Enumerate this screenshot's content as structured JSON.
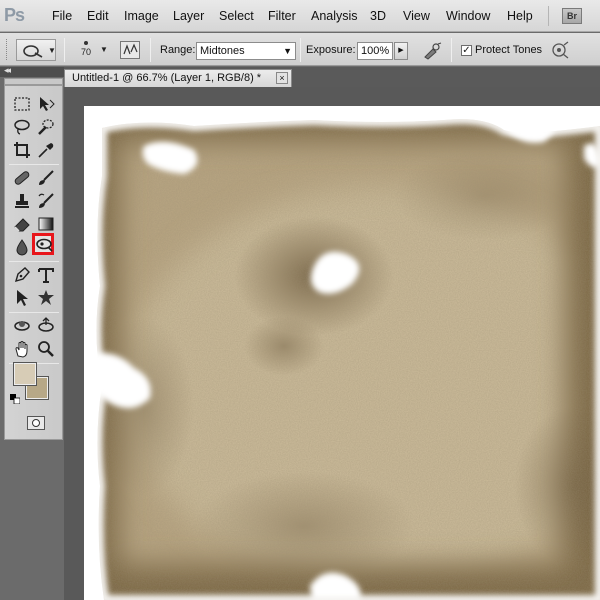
{
  "app": {
    "logo": "Ps",
    "menu": [
      "File",
      "Edit",
      "Image",
      "Layer",
      "Select",
      "Filter",
      "Analysis",
      "3D",
      "View",
      "Window",
      "Help"
    ],
    "bridge_button": "Br"
  },
  "options": {
    "tool_preset_icon": "burn-tool-icon",
    "brush_size": "70",
    "range_label": "Range:",
    "range_value": "Midtones",
    "exposure_label": "Exposure:",
    "exposure_value": "100%",
    "protect_tones_label": "Protect Tones",
    "protect_tones_checked": true
  },
  "document": {
    "tab_title": "Untitled-1 @ 66.7% (Layer 1, RGB/8) *",
    "close_glyph": "×"
  },
  "tools": {
    "selected": "burn-tool",
    "foreground_color": "#d7ccb6",
    "background_color": "#b7a887",
    "items": [
      "marquee-tool",
      "move-tool",
      "lasso-tool",
      "quick-selection-tool",
      "crop-tool",
      "eyedropper-tool",
      "healing-brush-tool",
      "brush-tool",
      "clone-stamp-tool",
      "history-brush-tool",
      "eraser-tool",
      "gradient-tool",
      "blur-tool",
      "burn-tool",
      "pen-tool",
      "type-tool",
      "path-selection-tool",
      "custom-shape-tool",
      "3d-rotate-tool",
      "3d-orbit-tool",
      "hand-tool",
      "zoom-tool"
    ]
  },
  "colors": {
    "parchment_light": "#cfc0a1",
    "parchment_mid": "#b19d78",
    "parchment_dark": "#7d6a4a",
    "selection_highlight": "#e8161b"
  }
}
